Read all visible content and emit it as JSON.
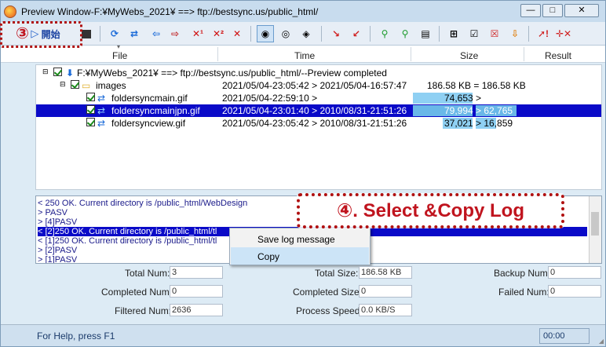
{
  "window": {
    "title": "Preview Window-F:¥MyWebs_2021¥ ==> ftp://bestsync.us/public_html/",
    "min": "—",
    "max": "□",
    "close": "✕"
  },
  "toolbar": {
    "start_label": "開始"
  },
  "columns": {
    "file": "File",
    "time": "Time",
    "size": "Size",
    "result": "Result"
  },
  "tree": {
    "root": "F:¥MyWebs_2021¥ ==> ftp://bestsync.us/public_html/--Preview completed",
    "rows": [
      {
        "name": "images",
        "time": "2021/05/04-23:05:42 > 2021/05/04-16:57:47",
        "size": "186.58 KB = 186.58 KB"
      },
      {
        "name": "foldersyncmain.gif",
        "time": "2021/05/04-22:59:10 >",
        "size": "74,653 >"
      },
      {
        "name": "foldersyncmainjpn.gif",
        "time": "2021/05/04-23:01:40 > 2010/08/31-21:51:26",
        "size": "79,994 > 62,765"
      },
      {
        "name": "foldersyncview.gif",
        "time": "2021/05/04-23:05:42 > 2010/08/31-21:51:26",
        "size": "37,021 > 16,859"
      }
    ]
  },
  "log": {
    "lines": [
      "< 250 OK. Current directory is /public_html/WebDesign",
      "> PASV",
      "> [4]PASV",
      "< [2]250 OK. Current directory is /public_html/tl",
      "< [1]250 OK. Current directory is /public_html/tl",
      "> [2]PASV",
      "> [1]PASV"
    ]
  },
  "context_menu": {
    "items": [
      "Save log message",
      "Copy"
    ]
  },
  "stats": {
    "total_num_label": "Total Num:",
    "total_num": "3",
    "completed_num_label": "Completed Num:",
    "completed_num": "0",
    "filtered_num_label": "Filtered Num:",
    "filtered_num": "2636",
    "total_size_label": "Total Size:",
    "total_size": "186.58 KB",
    "completed_size_label": "Completed Size:",
    "completed_size": "0",
    "process_speed_label": "Process Speed:",
    "process_speed": "0.0 KB/S",
    "backup_num_label": "Backup Num:",
    "backup_num": "0",
    "failed_num_label": "Failed Num:",
    "failed_num": "0"
  },
  "status": {
    "help": "For Help, press F1",
    "time": "00:00"
  },
  "annotations": {
    "step3": "③",
    "step4": "④. Select &Copy Log"
  },
  "colors": {
    "accent": "#0a0ac8",
    "callout": "#c0141e"
  }
}
